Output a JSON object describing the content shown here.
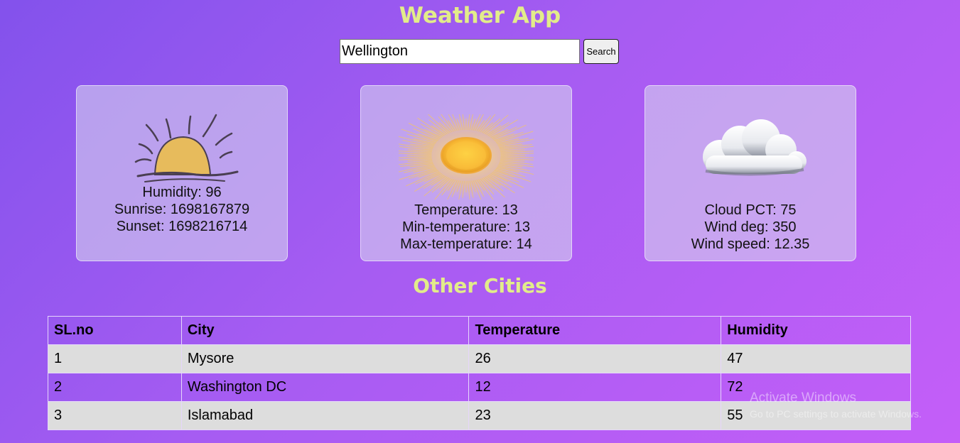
{
  "app": {
    "title": "Weather App"
  },
  "search": {
    "value": "Wellington",
    "button_label": "Search"
  },
  "cards": [
    {
      "icon": "sunrise-icon",
      "lines": [
        "Humidity: 96",
        "Sunrise: 1698167879",
        "Sunset: 1698216714"
      ]
    },
    {
      "icon": "sun-icon",
      "lines": [
        "Temperature: 13",
        "Min-temperature: 13",
        "Max-temperature: 14"
      ]
    },
    {
      "icon": "cloud-icon",
      "lines": [
        "Cloud PCT: 75",
        "Wind deg: 350",
        "Wind speed: 12.35"
      ]
    }
  ],
  "other_cities": {
    "title": "Other Cities",
    "columns": [
      "SL.no",
      "City",
      "Temperature",
      "Humidity"
    ],
    "rows": [
      [
        "1",
        "Mysore",
        "26",
        "47"
      ],
      [
        "2",
        "Washington DC",
        "12",
        "72"
      ],
      [
        "3",
        "Islamabad",
        "23",
        "55"
      ]
    ]
  },
  "watermark": {
    "line1": "Activate Windows",
    "line2": "Go to PC settings to activate Windows."
  },
  "colors": {
    "heading": "#e2ec8a",
    "background_start": "#8352ec",
    "background_end": "#c45ef8",
    "card_bg": "rgba(215,215,238,0.58)",
    "row_stripe": "#dddddd"
  }
}
